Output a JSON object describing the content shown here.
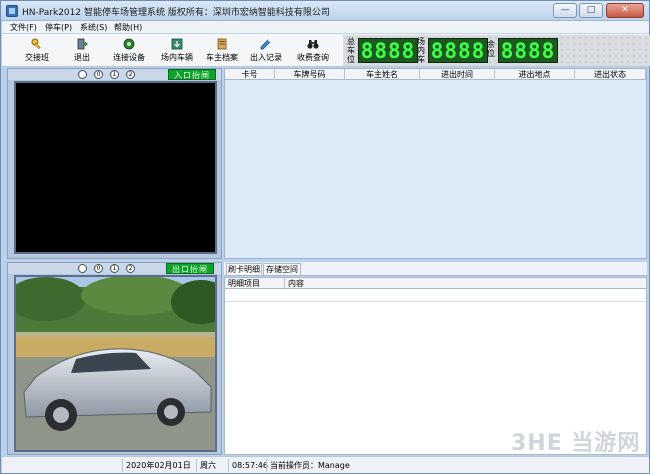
{
  "window": {
    "title": "HN-Park2012 智能停车场管理系统 版权所有：深圳市宏纳智能科技有限公司",
    "buttons": {
      "minimize": "—",
      "maximize": "□",
      "close": "✕"
    }
  },
  "menu": [
    "文件(F)",
    "停车(P)",
    "系统(S)",
    "帮助(H)"
  ],
  "toolbar": {
    "buttons": [
      "交接班",
      "退出",
      "连接设备",
      "场内车辆",
      "车主档案",
      "出入记录",
      "收费查询"
    ],
    "icons": [
      "key-icon",
      "exit-door-icon",
      "connect-device-icon",
      "parked-cars-icon",
      "owner-archive-icon",
      "access-record-icon",
      "binoculars-icon"
    ],
    "counters": [
      {
        "label": "总车位",
        "value": "8888"
      },
      {
        "label": "场内车",
        "value": "8888"
      },
      {
        "label": "余位",
        "value": "8888"
      }
    ]
  },
  "entry_panel": {
    "radios": [
      "0",
      "1",
      "2"
    ],
    "gate_button": "入口抬闸"
  },
  "exit_panel": {
    "radios": [
      "0",
      "1",
      "2"
    ],
    "gate_button": "出口抬闸"
  },
  "records_table": {
    "columns": [
      "卡号",
      "车牌号码",
      "车主姓名",
      "进出时间",
      "进出地点",
      "进出状态"
    ],
    "rows": []
  },
  "detail": {
    "tabs": [
      "刷卡明细",
      "存储空间"
    ],
    "columns": [
      "明细项目",
      "内容"
    ],
    "rows": []
  },
  "status": {
    "date": "2020年02月01日",
    "weekday": "周六",
    "time": "08:57:46",
    "operator": "当前操作员：Manage"
  },
  "watermark": "3HE 当游网",
  "colors": {
    "lcd_bg": "#1c5a1f",
    "lcd_fg": "#3dff4a",
    "gate_green": "#0ea32c"
  }
}
